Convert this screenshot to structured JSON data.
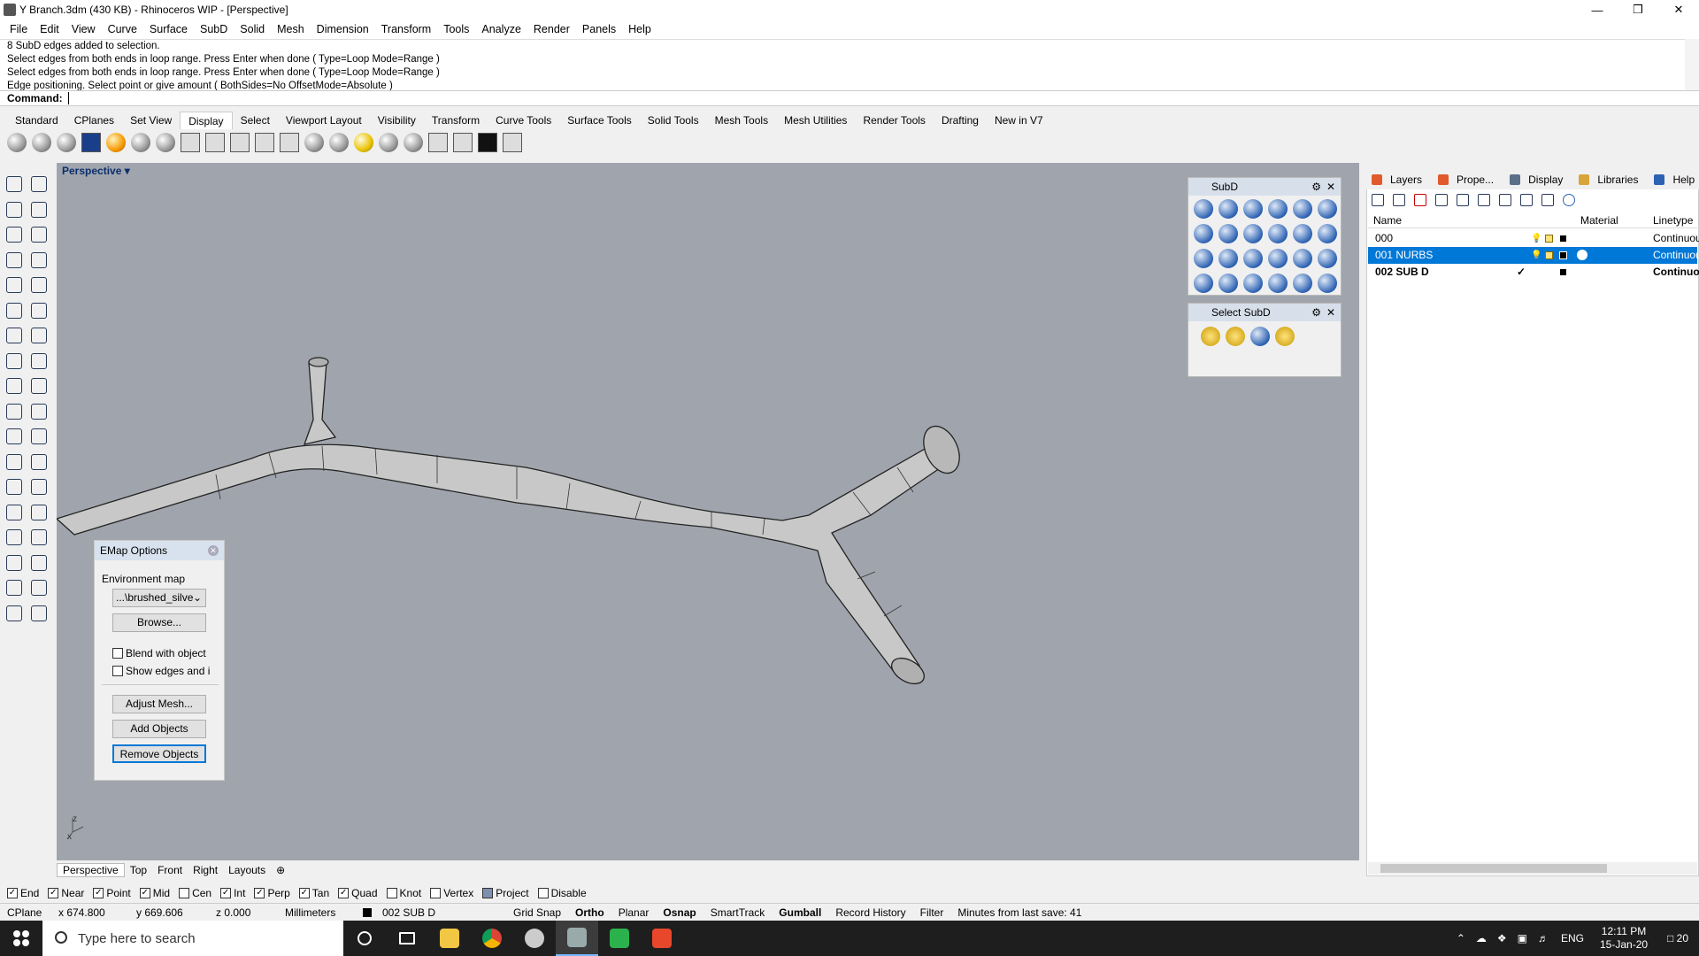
{
  "window": {
    "title": "Y Branch.3dm (430 KB) - Rhinoceros WIP - [Perspective]",
    "controls": [
      "—",
      "❒",
      "✕"
    ]
  },
  "menu": [
    "File",
    "Edit",
    "View",
    "Curve",
    "Surface",
    "SubD",
    "Solid",
    "Mesh",
    "Dimension",
    "Transform",
    "Tools",
    "Analyze",
    "Render",
    "Panels",
    "Help"
  ],
  "command_history": [
    "8 SubD edges added to selection.",
    "Select edges from both ends in loop range. Press Enter when done ( Type=Loop  Mode=Range )",
    "Select edges from both ends in loop range. Press Enter when done ( Type=Loop  Mode=Range )",
    "Edge positioning. Select point or give amount ( BothSides=No  OffsetMode=Absolute )"
  ],
  "command_prompt": "Command:",
  "toolbar_tabs": [
    "Standard",
    "CPlanes",
    "Set View",
    "Display",
    "Select",
    "Viewport Layout",
    "Visibility",
    "Transform",
    "Curve Tools",
    "Surface Tools",
    "Solid Tools",
    "Mesh Tools",
    "Mesh Utilities",
    "Render Tools",
    "Drafting",
    "New in V7"
  ],
  "active_toolbar_tab": "Display",
  "viewport": {
    "name": "Perspective",
    "axis_label_z": "z",
    "axis_label_x": "x"
  },
  "viewport_tabs": [
    "Perspective",
    "Top",
    "Front",
    "Right",
    "Layouts"
  ],
  "viewport_tab_add": "⊕",
  "subd_panel": {
    "title": "SubD"
  },
  "select_subd_panel": {
    "title": "Select SubD"
  },
  "emap": {
    "title": "EMap Options",
    "env_map_label": "Environment map",
    "env_map_value": "...\\brushed_silve",
    "browse": "Browse...",
    "blend": "Blend with object",
    "show_edges": "Show edges and i",
    "adjust_mesh": "Adjust Mesh...",
    "add_objects": "Add Objects",
    "remove_objects": "Remove Objects"
  },
  "right_panel": {
    "tabs": [
      "Layers",
      "Prope...",
      "Display",
      "Libraries",
      "Help"
    ],
    "columns": {
      "name": "Name",
      "material": "Material",
      "linetype": "Linetype"
    },
    "layers": [
      {
        "name": "000",
        "linetype": "Continuou",
        "selected": false,
        "bold": false,
        "current": false
      },
      {
        "name": "001 NURBS",
        "linetype": "Continuou",
        "selected": true,
        "bold": false,
        "current": false
      },
      {
        "name": "002 SUB D",
        "linetype": "Continuou",
        "selected": false,
        "bold": true,
        "current": true
      }
    ]
  },
  "osnaps": [
    {
      "label": "End",
      "checked": true
    },
    {
      "label": "Near",
      "checked": true
    },
    {
      "label": "Point",
      "checked": true
    },
    {
      "label": "Mid",
      "checked": true
    },
    {
      "label": "Cen",
      "checked": false
    },
    {
      "label": "Int",
      "checked": true
    },
    {
      "label": "Perp",
      "checked": true
    },
    {
      "label": "Tan",
      "checked": true
    },
    {
      "label": "Quad",
      "checked": true
    },
    {
      "label": "Knot",
      "checked": false
    },
    {
      "label": "Vertex",
      "checked": false
    },
    {
      "label": "Project",
      "checked": true
    },
    {
      "label": "Disable",
      "checked": false
    }
  ],
  "status": {
    "cplane": "CPlane",
    "x": "x 674.800",
    "y": "y 669.606",
    "z": "z 0.000",
    "units": "Millimeters",
    "layer": "002 SUB D",
    "toggles": [
      {
        "label": "Grid Snap",
        "bold": false
      },
      {
        "label": "Ortho",
        "bold": true
      },
      {
        "label": "Planar",
        "bold": false
      },
      {
        "label": "Osnap",
        "bold": true
      },
      {
        "label": "SmartTrack",
        "bold": false
      },
      {
        "label": "Gumball",
        "bold": true
      },
      {
        "label": "Record History",
        "bold": false
      },
      {
        "label": "Filter",
        "bold": false
      }
    ],
    "save_info": "Minutes from last save: 41"
  },
  "taskbar": {
    "search_placeholder": "Type here to search",
    "lang": "ENG",
    "time": "12:11 PM",
    "date": "15-Jan-20",
    "notifications": "20"
  },
  "colors": {
    "selection": "#0078d7",
    "viewport_bg": "#a0a5ad",
    "viewport_label": "#0c2d6c"
  }
}
